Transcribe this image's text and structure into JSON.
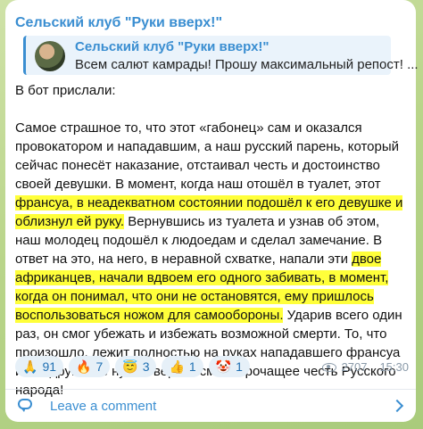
{
  "channel": {
    "title": "Сельский клуб \"Руки вверх!\""
  },
  "quote": {
    "title": "Сельский клуб \"Руки вверх!\"",
    "text": "Всем салют камрады! Прошу максимальный репост! ..."
  },
  "body": {
    "intro": "В бот прислали:",
    "parts": [
      "Самое страшное то, что этот «габонец» сам и оказался провокатором и нападавшим, а наш русский парень, который сейчас понесёт наказание, отстаивал честь и достоинство своей девушки. В момент, когда наш отошёл в туалет, этот ",
      "франсуа, в неадекватном состоянии подошёл к его девушке и облизнул ей руку.",
      " Вернувшись из туалета и узнав об этом, наш молодец подошёл к людоедам и сделал замечание. В ответ на это, на него, в неравной схватке, напали эти ",
      "двое африканцев, начали вдвоем его одного забивать, в момент, когда он понимал, что они не остановятся, ему пришлось воспользоваться ножом для самообороны.",
      " Ударив всего один раз, он смог убежать и избежать возможной смерти. То, что произошло, лежит полностью на руках нападавшего франсуа и его друга. Не нужно верить сми, порочащее честь Русского народа!"
    ]
  },
  "reactions": [
    {
      "emoji": "🙏",
      "count": "91"
    },
    {
      "emoji": "🔥",
      "count": "7"
    },
    {
      "emoji": "😇",
      "count": "3"
    },
    {
      "emoji": "👍",
      "count": "1"
    },
    {
      "emoji": "🤡",
      "count": "1"
    }
  ],
  "meta": {
    "views": "2707",
    "time": "15:30"
  },
  "comments": {
    "label": "Leave a comment"
  },
  "colors": {
    "accent": "#3a8ed1",
    "highlight": "#ffff3a"
  }
}
